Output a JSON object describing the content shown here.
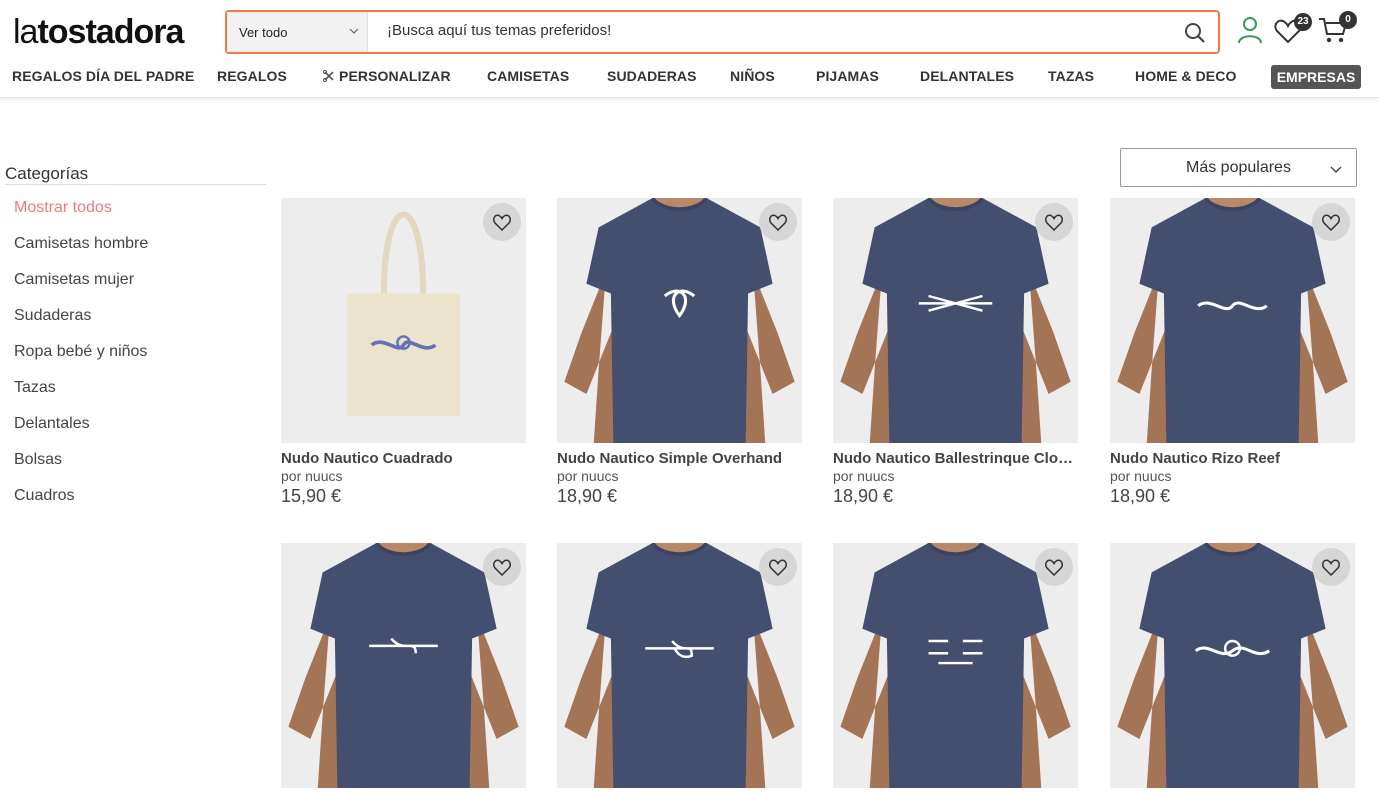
{
  "header": {
    "logo_light": "la",
    "logo_bold": "tostadora",
    "search": {
      "category": "Ver todo",
      "placeholder": "¡Busca aquí tus temas preferidos!"
    },
    "favorites_count": "23",
    "cart_count": "0"
  },
  "nav": {
    "items": [
      "REGALOS DÍA DEL PADRE",
      "REGALOS",
      "PERSONALIZAR",
      "CAMISETAS",
      "SUDADERAS",
      "NIÑOS",
      "PIJAMAS",
      "DELANTALES",
      "TAZAS",
      "HOME & DECO"
    ],
    "empresas": "EMPRESAS"
  },
  "sidebar": {
    "title": "Categorías",
    "items": [
      "Mostrar todos",
      "Camisetas hombre",
      "Camisetas mujer",
      "Sudaderas",
      "Ropa bebé y niños",
      "Tazas",
      "Delantales",
      "Bolsas",
      "Cuadros"
    ]
  },
  "sort": {
    "label": "Más populares"
  },
  "products": [
    {
      "name": "Nudo Nautico Cuadrado",
      "author": "por nuucs",
      "price": "15,90 €",
      "kind": "bag"
    },
    {
      "name": "Nudo Nautico Simple Overhand",
      "author": "por nuucs",
      "price": "18,90 €",
      "kind": "tshirt"
    },
    {
      "name": "Nudo Nautico Ballestrinque Clo…",
      "author": "por nuucs",
      "price": "18,90 €",
      "kind": "tshirt"
    },
    {
      "name": "Nudo Nautico Rizo Reef",
      "author": "por nuucs",
      "price": "18,90 €",
      "kind": "tshirt"
    },
    {
      "name": "",
      "author": "",
      "price": "",
      "kind": "tshirt"
    },
    {
      "name": "",
      "author": "",
      "price": "",
      "kind": "tshirt"
    },
    {
      "name": "",
      "author": "",
      "price": "",
      "kind": "tshirt"
    },
    {
      "name": "",
      "author": "",
      "price": "",
      "kind": "tshirt"
    }
  ],
  "colors": {
    "accent": "#f0784a",
    "active_category": "#f07a7a",
    "tshirt": "#444e6e",
    "user_icon": "#3a9a5a"
  }
}
